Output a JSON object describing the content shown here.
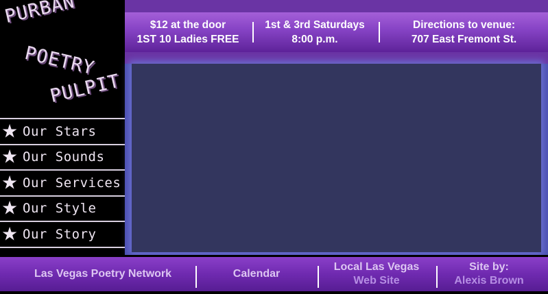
{
  "logo": {
    "line1": "PURBAN",
    "line2": "POETRY",
    "line3": "PULPIT"
  },
  "nav": [
    {
      "label": "Our Stars"
    },
    {
      "label": "Our Sounds"
    },
    {
      "label": "Our Services"
    },
    {
      "label": "Our Style"
    },
    {
      "label": "Our Story"
    }
  ],
  "info": {
    "admission": {
      "line1": "$12 at the door",
      "line2": "1ST 10 Ladies FREE"
    },
    "schedule": {
      "line1": "1st & 3rd Saturdays",
      "line2": "8:00 p.m."
    },
    "directions": {
      "line1": "Directions to venue:",
      "line2": "707 East Fremont St."
    }
  },
  "footer": {
    "network": {
      "label": "Las Vegas Poetry Network"
    },
    "calendar": {
      "label": "Calendar"
    },
    "local": {
      "line1": "Local Las Vegas",
      "line2": "Web Site"
    },
    "credit": {
      "line1": "Site by:",
      "line2": "Alexis Brown"
    }
  },
  "colors": {
    "band_purple": "#8542c4",
    "main_panel": "#33365e",
    "text_lavender": "#ddc6f2"
  }
}
